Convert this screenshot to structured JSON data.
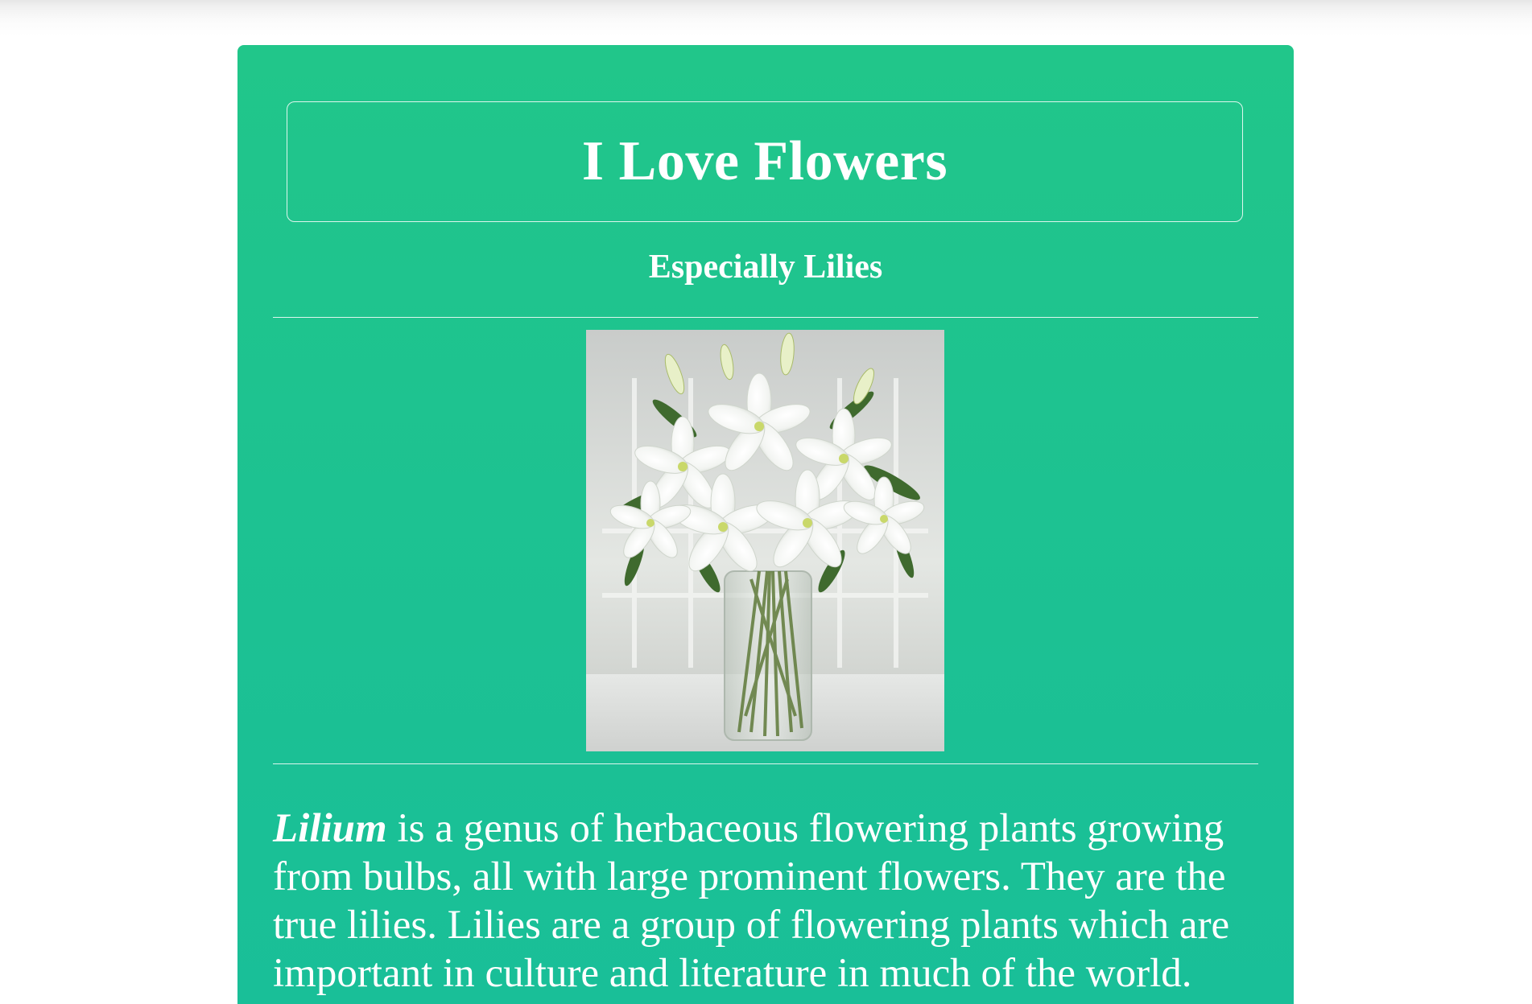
{
  "page": {
    "title": "I Love Flowers",
    "subtitle": "Especially Lilies"
  },
  "image": {
    "subject": "white lilies in a glass vase"
  },
  "description": {
    "genus": "Lilium",
    "text": " is a genus of herbaceous flowering plants growing from bulbs, all with large prominent flowers. They are the true lilies. Lilies are a group of flowering plants which are important in culture and literature in much of the world."
  },
  "colors": {
    "card_top": "#21c68a",
    "card_bottom": "#19bf98",
    "text": "#ffffff"
  }
}
